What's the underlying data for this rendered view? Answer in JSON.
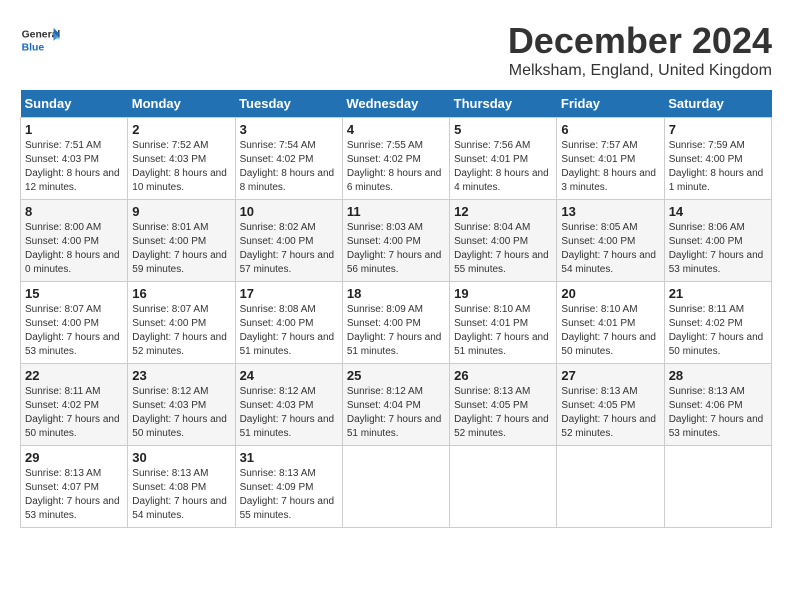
{
  "header": {
    "logo_text_general": "General",
    "logo_text_blue": "Blue",
    "month_title": "December 2024",
    "location": "Melksham, England, United Kingdom"
  },
  "weekdays": [
    "Sunday",
    "Monday",
    "Tuesday",
    "Wednesday",
    "Thursday",
    "Friday",
    "Saturday"
  ],
  "weeks": [
    [
      {
        "day": "1",
        "sunrise": "7:51 AM",
        "sunset": "4:03 PM",
        "daylight": "8 hours and 12 minutes."
      },
      {
        "day": "2",
        "sunrise": "7:52 AM",
        "sunset": "4:03 PM",
        "daylight": "8 hours and 10 minutes."
      },
      {
        "day": "3",
        "sunrise": "7:54 AM",
        "sunset": "4:02 PM",
        "daylight": "8 hours and 8 minutes."
      },
      {
        "day": "4",
        "sunrise": "7:55 AM",
        "sunset": "4:02 PM",
        "daylight": "8 hours and 6 minutes."
      },
      {
        "day": "5",
        "sunrise": "7:56 AM",
        "sunset": "4:01 PM",
        "daylight": "8 hours and 4 minutes."
      },
      {
        "day": "6",
        "sunrise": "7:57 AM",
        "sunset": "4:01 PM",
        "daylight": "8 hours and 3 minutes."
      },
      {
        "day": "7",
        "sunrise": "7:59 AM",
        "sunset": "4:00 PM",
        "daylight": "8 hours and 1 minute."
      }
    ],
    [
      {
        "day": "8",
        "sunrise": "8:00 AM",
        "sunset": "4:00 PM",
        "daylight": "8 hours and 0 minutes."
      },
      {
        "day": "9",
        "sunrise": "8:01 AM",
        "sunset": "4:00 PM",
        "daylight": "7 hours and 59 minutes."
      },
      {
        "day": "10",
        "sunrise": "8:02 AM",
        "sunset": "4:00 PM",
        "daylight": "7 hours and 57 minutes."
      },
      {
        "day": "11",
        "sunrise": "8:03 AM",
        "sunset": "4:00 PM",
        "daylight": "7 hours and 56 minutes."
      },
      {
        "day": "12",
        "sunrise": "8:04 AM",
        "sunset": "4:00 PM",
        "daylight": "7 hours and 55 minutes."
      },
      {
        "day": "13",
        "sunrise": "8:05 AM",
        "sunset": "4:00 PM",
        "daylight": "7 hours and 54 minutes."
      },
      {
        "day": "14",
        "sunrise": "8:06 AM",
        "sunset": "4:00 PM",
        "daylight": "7 hours and 53 minutes."
      }
    ],
    [
      {
        "day": "15",
        "sunrise": "8:07 AM",
        "sunset": "4:00 PM",
        "daylight": "7 hours and 53 minutes."
      },
      {
        "day": "16",
        "sunrise": "8:07 AM",
        "sunset": "4:00 PM",
        "daylight": "7 hours and 52 minutes."
      },
      {
        "day": "17",
        "sunrise": "8:08 AM",
        "sunset": "4:00 PM",
        "daylight": "7 hours and 51 minutes."
      },
      {
        "day": "18",
        "sunrise": "8:09 AM",
        "sunset": "4:00 PM",
        "daylight": "7 hours and 51 minutes."
      },
      {
        "day": "19",
        "sunrise": "8:10 AM",
        "sunset": "4:01 PM",
        "daylight": "7 hours and 51 minutes."
      },
      {
        "day": "20",
        "sunrise": "8:10 AM",
        "sunset": "4:01 PM",
        "daylight": "7 hours and 50 minutes."
      },
      {
        "day": "21",
        "sunrise": "8:11 AM",
        "sunset": "4:02 PM",
        "daylight": "7 hours and 50 minutes."
      }
    ],
    [
      {
        "day": "22",
        "sunrise": "8:11 AM",
        "sunset": "4:02 PM",
        "daylight": "7 hours and 50 minutes."
      },
      {
        "day": "23",
        "sunrise": "8:12 AM",
        "sunset": "4:03 PM",
        "daylight": "7 hours and 50 minutes."
      },
      {
        "day": "24",
        "sunrise": "8:12 AM",
        "sunset": "4:03 PM",
        "daylight": "7 hours and 51 minutes."
      },
      {
        "day": "25",
        "sunrise": "8:12 AM",
        "sunset": "4:04 PM",
        "daylight": "7 hours and 51 minutes."
      },
      {
        "day": "26",
        "sunrise": "8:13 AM",
        "sunset": "4:05 PM",
        "daylight": "7 hours and 52 minutes."
      },
      {
        "day": "27",
        "sunrise": "8:13 AM",
        "sunset": "4:05 PM",
        "daylight": "7 hours and 52 minutes."
      },
      {
        "day": "28",
        "sunrise": "8:13 AM",
        "sunset": "4:06 PM",
        "daylight": "7 hours and 53 minutes."
      }
    ],
    [
      {
        "day": "29",
        "sunrise": "8:13 AM",
        "sunset": "4:07 PM",
        "daylight": "7 hours and 53 minutes."
      },
      {
        "day": "30",
        "sunrise": "8:13 AM",
        "sunset": "4:08 PM",
        "daylight": "7 hours and 54 minutes."
      },
      {
        "day": "31",
        "sunrise": "8:13 AM",
        "sunset": "4:09 PM",
        "daylight": "7 hours and 55 minutes."
      },
      null,
      null,
      null,
      null
    ]
  ]
}
